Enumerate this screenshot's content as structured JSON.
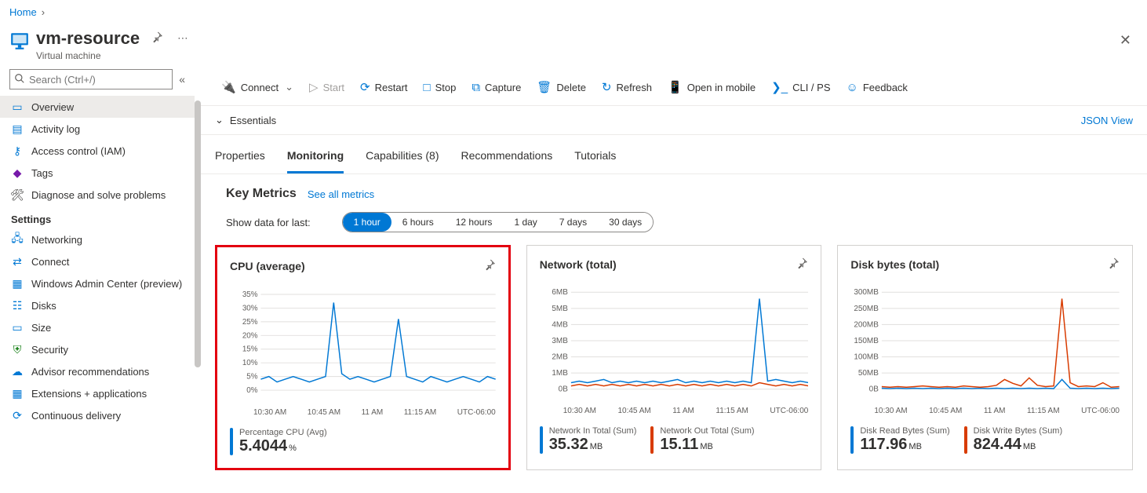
{
  "breadcrumb": {
    "home": "Home"
  },
  "header": {
    "title": "vm-resource",
    "subtitle": "Virtual machine"
  },
  "sidebar": {
    "search_placeholder": "Search (Ctrl+/)",
    "items": [
      {
        "label": "Overview"
      },
      {
        "label": "Activity log"
      },
      {
        "label": "Access control (IAM)"
      },
      {
        "label": "Tags"
      },
      {
        "label": "Diagnose and solve problems"
      }
    ],
    "settings_heading": "Settings",
    "settings": [
      {
        "label": "Networking"
      },
      {
        "label": "Connect"
      },
      {
        "label": "Windows Admin Center (preview)"
      },
      {
        "label": "Disks"
      },
      {
        "label": "Size"
      },
      {
        "label": "Security"
      },
      {
        "label": "Advisor recommendations"
      },
      {
        "label": "Extensions + applications"
      },
      {
        "label": "Continuous delivery"
      }
    ]
  },
  "toolbar": {
    "connect": "Connect",
    "start": "Start",
    "restart": "Restart",
    "stop": "Stop",
    "capture": "Capture",
    "delete": "Delete",
    "refresh": "Refresh",
    "open_mobile": "Open in mobile",
    "cli": "CLI / PS",
    "feedback": "Feedback"
  },
  "essentials": {
    "label": "Essentials",
    "json_view": "JSON View"
  },
  "tabs": {
    "properties": "Properties",
    "monitoring": "Monitoring",
    "capabilities": "Capabilities (8)",
    "recommendations": "Recommendations",
    "tutorials": "Tutorials"
  },
  "metrics": {
    "heading": "Key Metrics",
    "see_all": "See all metrics",
    "show_label": "Show data for last:",
    "ranges": [
      "1 hour",
      "6 hours",
      "12 hours",
      "1 day",
      "7 days",
      "30 days"
    ]
  },
  "chart_data": [
    {
      "type": "line",
      "title": "CPU (average)",
      "ylabel": "%",
      "ylim": [
        0,
        35
      ],
      "yticks": [
        "0%",
        "5%",
        "10%",
        "15%",
        "20%",
        "25%",
        "30%",
        "35%"
      ],
      "x_ticks": [
        "10:30 AM",
        "10:45 AM",
        "11 AM",
        "11:15 AM"
      ],
      "tz": "UTC-06:00",
      "series": [
        {
          "name": "Percentage CPU (Avg)",
          "color": "#0078d4",
          "values": [
            4,
            5,
            3,
            4,
            5,
            4,
            3,
            4,
            5,
            32,
            6,
            4,
            5,
            4,
            3,
            4,
            5,
            26,
            5,
            4,
            3,
            5,
            4,
            3,
            4,
            5,
            4,
            3,
            5,
            4
          ]
        }
      ],
      "summary": [
        {
          "label": "Percentage CPU (Avg)",
          "value": "5.4044",
          "unit": "%",
          "color": "blue"
        }
      ]
    },
    {
      "type": "line",
      "title": "Network (total)",
      "ylabel": "MB",
      "ylim": [
        0,
        6
      ],
      "yticks": [
        "0B",
        "1MB",
        "2MB",
        "3MB",
        "4MB",
        "5MB",
        "6MB"
      ],
      "x_ticks": [
        "10:30 AM",
        "10:45 AM",
        "11 AM",
        "11:15 AM"
      ],
      "tz": "UTC-06:00",
      "series": [
        {
          "name": "Network In Total (Sum)",
          "color": "#0078d4",
          "values": [
            0.4,
            0.5,
            0.4,
            0.5,
            0.6,
            0.4,
            0.5,
            0.4,
            0.5,
            0.4,
            0.5,
            0.4,
            0.5,
            0.6,
            0.4,
            0.5,
            0.4,
            0.5,
            0.4,
            0.5,
            0.4,
            0.5,
            0.4,
            5.6,
            0.5,
            0.6,
            0.5,
            0.4,
            0.5,
            0.4
          ]
        },
        {
          "name": "Network Out Total (Sum)",
          "color": "#d83b01",
          "values": [
            0.2,
            0.3,
            0.2,
            0.3,
            0.2,
            0.3,
            0.2,
            0.3,
            0.2,
            0.3,
            0.2,
            0.3,
            0.2,
            0.3,
            0.2,
            0.3,
            0.2,
            0.3,
            0.2,
            0.3,
            0.2,
            0.3,
            0.2,
            0.4,
            0.3,
            0.2,
            0.3,
            0.2,
            0.3,
            0.2
          ]
        }
      ],
      "summary": [
        {
          "label": "Network In Total (Sum)",
          "value": "35.32",
          "unit": "MB",
          "color": "blue"
        },
        {
          "label": "Network Out Total (Sum)",
          "value": "15.11",
          "unit": "MB",
          "color": "orange"
        }
      ]
    },
    {
      "type": "line",
      "title": "Disk bytes (total)",
      "ylabel": "MB",
      "ylim": [
        0,
        300
      ],
      "yticks": [
        "0B",
        "50MB",
        "100MB",
        "150MB",
        "200MB",
        "250MB",
        "300MB"
      ],
      "x_ticks": [
        "10:30 AM",
        "10:45 AM",
        "11 AM",
        "11:15 AM"
      ],
      "tz": "UTC-06:00",
      "series": [
        {
          "name": "Disk Read Bytes (Sum)",
          "color": "#0078d4",
          "values": [
            3,
            2,
            3,
            2,
            3,
            2,
            3,
            2,
            3,
            2,
            3,
            2,
            3,
            2,
            3,
            2,
            3,
            2,
            3,
            2,
            3,
            2,
            30,
            3,
            2,
            3,
            2,
            3,
            2,
            3
          ]
        },
        {
          "name": "Disk Write Bytes (Sum)",
          "color": "#d83b01",
          "values": [
            8,
            6,
            8,
            6,
            8,
            10,
            8,
            6,
            8,
            6,
            10,
            8,
            6,
            8,
            12,
            30,
            18,
            10,
            35,
            12,
            8,
            10,
            280,
            20,
            8,
            10,
            8,
            20,
            6,
            8
          ]
        }
      ],
      "summary": [
        {
          "label": "Disk Read Bytes (Sum)",
          "value": "117.96",
          "unit": "MB",
          "color": "blue"
        },
        {
          "label": "Disk Write Bytes (Sum)",
          "value": "824.44",
          "unit": "MB",
          "color": "orange"
        }
      ]
    }
  ]
}
